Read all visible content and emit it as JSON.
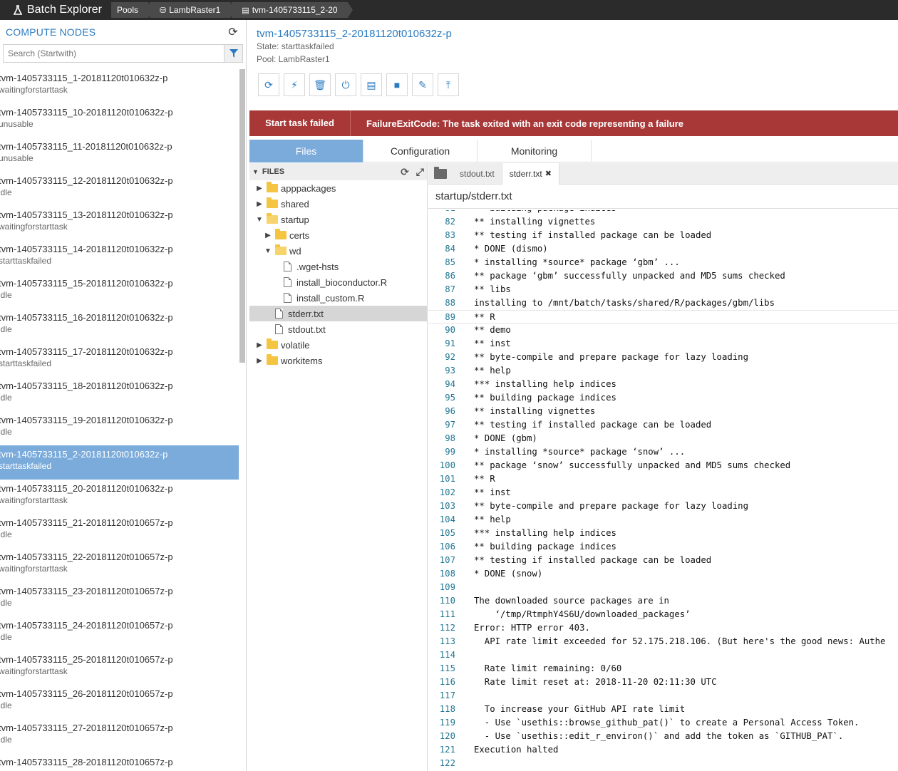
{
  "app": {
    "title": "Batch Explorer",
    "breadcrumbs": [
      "Pools",
      "LambRaster1",
      "tvm-1405733115_2-20"
    ]
  },
  "left_panel": {
    "title": "COMPUTE NODES",
    "search_placeholder": "Search (Startwith)",
    "nodes": [
      {
        "id": "tvm-1405733115_1-20181120t010632z-p",
        "state": "waitingforstarttask"
      },
      {
        "id": "tvm-1405733115_10-20181120t010632z-p",
        "state": "unusable"
      },
      {
        "id": "tvm-1405733115_11-20181120t010632z-p",
        "state": "unusable"
      },
      {
        "id": "tvm-1405733115_12-20181120t010632z-p",
        "state": "idle"
      },
      {
        "id": "tvm-1405733115_13-20181120t010632z-p",
        "state": "waitingforstarttask"
      },
      {
        "id": "tvm-1405733115_14-20181120t010632z-p",
        "state": "starttaskfailed"
      },
      {
        "id": "tvm-1405733115_15-20181120t010632z-p",
        "state": "idle"
      },
      {
        "id": "tvm-1405733115_16-20181120t010632z-p",
        "state": "idle"
      },
      {
        "id": "tvm-1405733115_17-20181120t010632z-p",
        "state": "starttaskfailed"
      },
      {
        "id": "tvm-1405733115_18-20181120t010632z-p",
        "state": "idle"
      },
      {
        "id": "tvm-1405733115_19-20181120t010632z-p",
        "state": "idle"
      },
      {
        "id": "tvm-1405733115_2-20181120t010632z-p",
        "state": "starttaskfailed"
      },
      {
        "id": "tvm-1405733115_20-20181120t010632z-p",
        "state": "waitingforstarttask"
      },
      {
        "id": "tvm-1405733115_21-20181120t010657z-p",
        "state": "idle"
      },
      {
        "id": "tvm-1405733115_22-20181120t010657z-p",
        "state": "waitingforstarttask"
      },
      {
        "id": "tvm-1405733115_23-20181120t010657z-p",
        "state": "idle"
      },
      {
        "id": "tvm-1405733115_24-20181120t010657z-p",
        "state": "idle"
      },
      {
        "id": "tvm-1405733115_25-20181120t010657z-p",
        "state": "waitingforstarttask"
      },
      {
        "id": "tvm-1405733115_26-20181120t010657z-p",
        "state": "idle"
      },
      {
        "id": "tvm-1405733115_27-20181120t010657z-p",
        "state": "idle"
      },
      {
        "id": "tvm-1405733115_28-20181120t010657z-p",
        "state": ""
      }
    ],
    "selected_index": 11
  },
  "node_details": {
    "title": "tvm-1405733115_2-20181120t010632z-p",
    "state": "State: starttaskfailed",
    "pool": "Pool: LambRaster1",
    "toolbar_icons": [
      "refresh-icon",
      "connect-icon",
      "delete-icon",
      "reboot-icon",
      "reimage-icon",
      "stop-icon",
      "edit-icon",
      "upload-logs-icon"
    ]
  },
  "error_bar": {
    "title": "Start task failed",
    "message": "FailureExitCode: The task exited with an exit code representing a failure"
  },
  "tabs": [
    "Files",
    "Configuration",
    "Monitoring"
  ],
  "active_tab": 0,
  "file_tree": {
    "header": "FILES",
    "rows": [
      {
        "label": "apppackages",
        "kind": "folder",
        "depth": 0,
        "expanded": false
      },
      {
        "label": "shared",
        "kind": "folder",
        "depth": 0,
        "expanded": false
      },
      {
        "label": "startup",
        "kind": "folder",
        "depth": 0,
        "expanded": true
      },
      {
        "label": "certs",
        "kind": "folder",
        "depth": 1,
        "expanded": false
      },
      {
        "label": "wd",
        "kind": "folder",
        "depth": 1,
        "expanded": true
      },
      {
        "label": ".wget-hsts",
        "kind": "file",
        "depth": 2
      },
      {
        "label": "install_bioconductor.R",
        "kind": "file",
        "depth": 2
      },
      {
        "label": "install_custom.R",
        "kind": "file",
        "depth": 2
      },
      {
        "label": "stderr.txt",
        "kind": "file",
        "depth": 1,
        "selected": true
      },
      {
        "label": "stdout.txt",
        "kind": "file",
        "depth": 1
      },
      {
        "label": "volatile",
        "kind": "folder",
        "depth": 0,
        "expanded": false
      },
      {
        "label": "workitems",
        "kind": "folder",
        "depth": 0,
        "expanded": false
      }
    ]
  },
  "editor": {
    "open_tabs": [
      {
        "label": "stdout.txt",
        "active": false
      },
      {
        "label": "stderr.txt",
        "active": true
      }
    ],
    "path": "startup/stderr.txt",
    "cursor_line": 89,
    "lines": [
      {
        "n": "81",
        "t": "** building package indices"
      },
      {
        "n": "82",
        "t": "** installing vignettes"
      },
      {
        "n": "83",
        "t": "** testing if installed package can be loaded"
      },
      {
        "n": "84",
        "t": "* DONE (dismo)"
      },
      {
        "n": "85",
        "t": "* installing *source* package ‘gbm’ ..."
      },
      {
        "n": "86",
        "t": "** package ‘gbm’ successfully unpacked and MD5 sums checked"
      },
      {
        "n": "87",
        "t": "** libs"
      },
      {
        "n": "88",
        "t": "installing to /mnt/batch/tasks/shared/R/packages/gbm/libs"
      },
      {
        "n": "89",
        "t": "** R"
      },
      {
        "n": "90",
        "t": "** demo"
      },
      {
        "n": "91",
        "t": "** inst"
      },
      {
        "n": "92",
        "t": "** byte-compile and prepare package for lazy loading"
      },
      {
        "n": "93",
        "t": "** help"
      },
      {
        "n": "94",
        "t": "*** installing help indices"
      },
      {
        "n": "95",
        "t": "** building package indices"
      },
      {
        "n": "96",
        "t": "** installing vignettes"
      },
      {
        "n": "97",
        "t": "** testing if installed package can be loaded"
      },
      {
        "n": "98",
        "t": "* DONE (gbm)"
      },
      {
        "n": "99",
        "t": "* installing *source* package ‘snow’ ..."
      },
      {
        "n": "100",
        "t": "** package ‘snow’ successfully unpacked and MD5 sums checked"
      },
      {
        "n": "101",
        "t": "** R"
      },
      {
        "n": "102",
        "t": "** inst"
      },
      {
        "n": "103",
        "t": "** byte-compile and prepare package for lazy loading"
      },
      {
        "n": "104",
        "t": "** help"
      },
      {
        "n": "105",
        "t": "*** installing help indices"
      },
      {
        "n": "106",
        "t": "** building package indices"
      },
      {
        "n": "107",
        "t": "** testing if installed package can be loaded"
      },
      {
        "n": "108",
        "t": "* DONE (snow)"
      },
      {
        "n": "109",
        "t": ""
      },
      {
        "n": "110",
        "t": "The downloaded source packages are in"
      },
      {
        "n": "111",
        "t": "    ‘/tmp/RtmphY4S6U/downloaded_packages’"
      },
      {
        "n": "112",
        "t": "Error: HTTP error 403."
      },
      {
        "n": "113",
        "t": "  API rate limit exceeded for 52.175.218.106. (But here's the good news: Authe"
      },
      {
        "n": "114",
        "t": ""
      },
      {
        "n": "115",
        "t": "  Rate limit remaining: 0/60"
      },
      {
        "n": "116",
        "t": "  Rate limit reset at: 2018-11-20 02:11:30 UTC"
      },
      {
        "n": "117",
        "t": ""
      },
      {
        "n": "118",
        "t": "  To increase your GitHub API rate limit"
      },
      {
        "n": "119",
        "t": "  - Use `usethis::browse_github_pat()` to create a Personal Access Token."
      },
      {
        "n": "120",
        "t": "  - Use `usethis::edit_r_environ()` and add the token as `GITHUB_PAT`."
      },
      {
        "n": "121",
        "t": "Execution halted"
      },
      {
        "n": "122",
        "t": ""
      }
    ]
  }
}
